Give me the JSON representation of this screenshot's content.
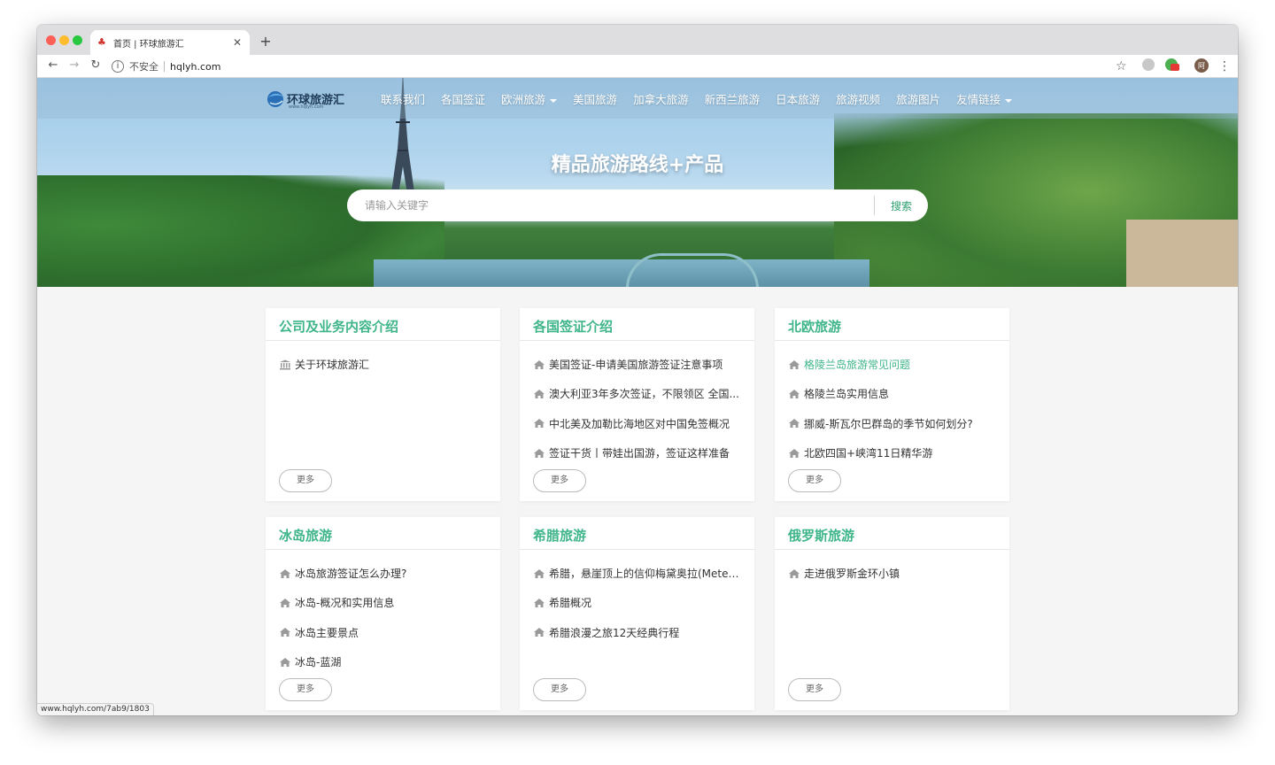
{
  "browser": {
    "tab_title": "首页 | 环球旅游汇",
    "tab_close": "✕",
    "new_tab": "+",
    "security_label": "不安全",
    "url": "hqlyh.com",
    "status_url": "www.hqlyh.com/7ab9/1803"
  },
  "site": {
    "logo_text": "环球旅游汇",
    "logo_sub": "www.hqlyh.com",
    "nav": [
      {
        "label": "联系我们",
        "dropdown": false
      },
      {
        "label": "各国签证",
        "dropdown": false
      },
      {
        "label": "欧洲旅游",
        "dropdown": true
      },
      {
        "label": "美国旅游",
        "dropdown": false
      },
      {
        "label": "加拿大旅游",
        "dropdown": false
      },
      {
        "label": "新西兰旅游",
        "dropdown": false
      },
      {
        "label": "日本旅游",
        "dropdown": false
      },
      {
        "label": "旅游视频",
        "dropdown": false
      },
      {
        "label": "旅游图片",
        "dropdown": false
      },
      {
        "label": "友情链接",
        "dropdown": true
      }
    ],
    "hero_title": "精品旅游路线+产品",
    "search_placeholder": "请输入关键字",
    "search_button": "搜索"
  },
  "cards": [
    {
      "title": "公司及业务内容介绍",
      "icon": "bank-icon",
      "items": [
        {
          "text": "关于环球旅游汇",
          "active": false
        }
      ],
      "more": "更多"
    },
    {
      "title": "各国签证介绍",
      "icon": "home-icon",
      "items": [
        {
          "text": "美国签证-申请美国旅游签证注意事项",
          "active": false
        },
        {
          "text": "澳大利亚3年多次签证，不限领区 全国...",
          "active": false
        },
        {
          "text": "中北美及加勒比海地区对中国免签概况",
          "active": false
        },
        {
          "text": "签证干货丨带娃出国游，签证这样准备",
          "active": false
        }
      ],
      "more": "更多"
    },
    {
      "title": "北欧旅游",
      "icon": "home-icon",
      "items": [
        {
          "text": "格陵兰岛旅游常见问题",
          "active": true
        },
        {
          "text": "格陵兰岛实用信息",
          "active": false
        },
        {
          "text": "挪威-斯瓦尔巴群岛的季节如何划分?",
          "active": false
        },
        {
          "text": "北欧四国+峡湾11日精华游",
          "active": false
        }
      ],
      "more": "更多"
    },
    {
      "title": "冰岛旅游",
      "icon": "home-icon",
      "items": [
        {
          "text": "冰岛旅游签证怎么办理?",
          "active": false
        },
        {
          "text": "冰岛-概况和实用信息",
          "active": false
        },
        {
          "text": "冰岛主要景点",
          "active": false
        },
        {
          "text": "冰岛-蓝湖",
          "active": false
        }
      ],
      "more": "更多"
    },
    {
      "title": "希腊旅游",
      "icon": "home-icon",
      "items": [
        {
          "text": "希腊，悬崖顶上的信仰梅黛奥拉(Meteora)",
          "active": false
        },
        {
          "text": "希腊概况",
          "active": false
        },
        {
          "text": "希腊浪漫之旅12天经典行程",
          "active": false
        }
      ],
      "more": "更多"
    },
    {
      "title": "俄罗斯旅游",
      "icon": "home-icon",
      "items": [
        {
          "text": "走进俄罗斯金环小镇",
          "active": false
        }
      ],
      "more": "更多"
    }
  ],
  "colors": {
    "accent": "#3fb58a"
  }
}
